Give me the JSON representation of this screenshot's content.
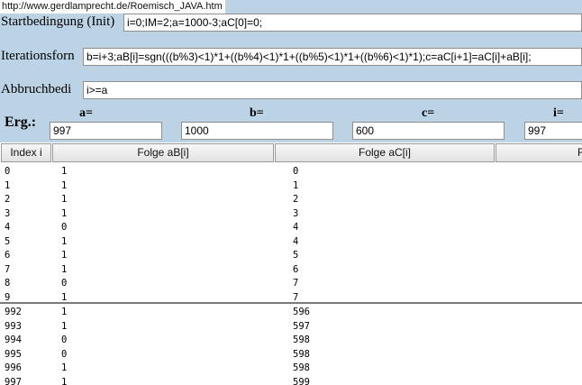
{
  "url": "http://www.gerdlamprecht.de/Roemisch_JAVA.htm",
  "fields": {
    "init_label": "Startbedingung (Init)",
    "init_value": "i=0;IM=2;a=1000-3;aC[0]=0;",
    "iter_label": "Iterationsforn",
    "iter_value": "b=i+3;aB[i]=sgn(((b%3)<1)*1+((b%4)<1)*1+((b%5)<1)*1+((b%6)<1)*1);c=aC[i+1]=aC[i]+aB[i];",
    "stop_label": "Abbruchbedi",
    "stop_value": "i>=a"
  },
  "results": {
    "label": "Erg.:",
    "a_label": "a=",
    "a_value": "997",
    "b_label": "b=",
    "b_value": "1000",
    "c_label": "c=",
    "c_value": "600",
    "i_label": "i=",
    "i_value": "997"
  },
  "table": {
    "headers": [
      "Index i",
      "Folge aB[i]",
      "Folge aC[i]",
      "F"
    ],
    "top_rows": [
      [
        "0",
        "1",
        "0"
      ],
      [
        "1",
        "1",
        "1"
      ],
      [
        "2",
        "1",
        "2"
      ],
      [
        "3",
        "1",
        "3"
      ],
      [
        "4",
        "0",
        "4"
      ],
      [
        "5",
        "1",
        "4"
      ],
      [
        "6",
        "1",
        "5"
      ],
      [
        "7",
        "1",
        "6"
      ],
      [
        "8",
        "0",
        "7"
      ],
      [
        "9",
        "1",
        "7"
      ]
    ],
    "bottom_rows": [
      [
        "992",
        "1",
        "596"
      ],
      [
        "993",
        "1",
        "597"
      ],
      [
        "994",
        "0",
        "598"
      ],
      [
        "995",
        "0",
        "598"
      ],
      [
        "996",
        "1",
        "598"
      ],
      [
        "997",
        "1",
        "599"
      ]
    ]
  }
}
